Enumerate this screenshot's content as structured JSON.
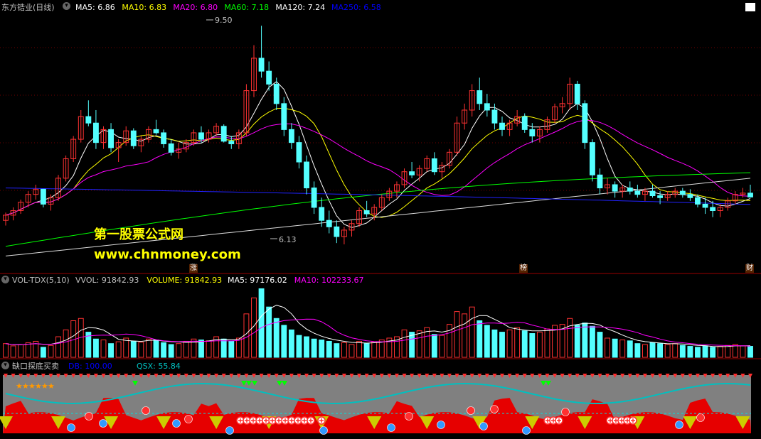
{
  "main_panel": {
    "title": "东方锆业(日线)",
    "ma_labels": [
      {
        "text": "MA5: 6.86",
        "color": "#ffffff"
      },
      {
        "text": "MA10: 6.83",
        "color": "#ffff00"
      },
      {
        "text": "MA20: 6.80",
        "color": "#ff00ff"
      },
      {
        "text": "MA60: 7.18",
        "color": "#00ff00"
      },
      {
        "text": "MA120: 7.24",
        "color": "#ffffff"
      },
      {
        "text": "MA250: 6.58",
        "color": "#0000ff"
      }
    ],
    "high_label": "9.50",
    "low_label": "6.13",
    "watermark_cn": "第一股票公式网",
    "watermark_url": "www.chnmoney.com",
    "badges": [
      "涨",
      "榜",
      "财"
    ]
  },
  "volume_panel": {
    "title": "VOL-TDX(5,10)",
    "labels": [
      {
        "text": "VVOL: 91842.93",
        "color": "#c0c0c0"
      },
      {
        "text": "VOLUME: 91842.93",
        "color": "#ffff00"
      },
      {
        "text": "MA5: 97176.02",
        "color": "#ffffff"
      },
      {
        "text": "MA10: 102233.67",
        "color": "#ff00ff"
      }
    ]
  },
  "indicator_panel": {
    "title": "缺口探底买卖",
    "labels": [
      {
        "text": "DB: 100.00",
        "color": "#0000ff"
      },
      {
        "text": "QSX: 55.84",
        "color": "#00c0c0"
      }
    ]
  },
  "chart_data": {
    "type": "candlestick",
    "price_range": [
      6.13,
      9.5
    ],
    "candles": [
      [
        6.5,
        6.62,
        6.42,
        6.58
      ],
      [
        6.58,
        6.7,
        6.5,
        6.65
      ],
      [
        6.65,
        6.82,
        6.6,
        6.78
      ],
      [
        6.78,
        6.95,
        6.7,
        6.9
      ],
      [
        6.9,
        7.05,
        6.82,
        6.98
      ],
      [
        6.98,
        6.95,
        6.7,
        6.75
      ],
      [
        6.75,
        6.9,
        6.65,
        6.85
      ],
      [
        6.85,
        7.2,
        6.8,
        7.15
      ],
      [
        7.15,
        7.5,
        7.1,
        7.45
      ],
      [
        7.45,
        7.8,
        7.4,
        7.75
      ],
      [
        7.75,
        8.2,
        7.7,
        8.1
      ],
      [
        8.1,
        8.35,
        7.95,
        8.0
      ],
      [
        8.0,
        8.2,
        7.6,
        7.7
      ],
      [
        7.7,
        7.95,
        7.6,
        7.9
      ],
      [
        7.9,
        8.0,
        7.55,
        7.62
      ],
      [
        7.62,
        7.75,
        7.4,
        7.7
      ],
      [
        7.7,
        7.95,
        7.65,
        7.88
      ],
      [
        7.88,
        7.92,
        7.6,
        7.65
      ],
      [
        7.65,
        7.8,
        7.55,
        7.75
      ],
      [
        7.75,
        7.95,
        7.7,
        7.9
      ],
      [
        7.9,
        8.05,
        7.82,
        7.85
      ],
      [
        7.85,
        7.9,
        7.62,
        7.68
      ],
      [
        7.68,
        7.75,
        7.5,
        7.55
      ],
      [
        7.55,
        7.7,
        7.45,
        7.6
      ],
      [
        7.6,
        7.75,
        7.55,
        7.7
      ],
      [
        7.7,
        7.9,
        7.65,
        7.85
      ],
      [
        7.85,
        7.95,
        7.7,
        7.75
      ],
      [
        7.75,
        7.9,
        7.7,
        7.85
      ],
      [
        7.85,
        8.0,
        7.8,
        7.95
      ],
      [
        7.95,
        7.98,
        7.7,
        7.72
      ],
      [
        7.72,
        7.8,
        7.6,
        7.68
      ],
      [
        7.68,
        7.9,
        7.6,
        7.85
      ],
      [
        7.85,
        8.6,
        7.8,
        8.5
      ],
      [
        8.5,
        9.2,
        8.4,
        9.0
      ],
      [
        9.0,
        9.5,
        8.7,
        8.8
      ],
      [
        8.8,
        8.95,
        8.5,
        8.6
      ],
      [
        8.6,
        8.7,
        8.2,
        8.3
      ],
      [
        8.3,
        8.4,
        7.8,
        7.9
      ],
      [
        7.9,
        8.0,
        7.6,
        7.7
      ],
      [
        7.7,
        7.8,
        7.3,
        7.4
      ],
      [
        7.4,
        7.5,
        6.9,
        7.0
      ],
      [
        7.0,
        7.1,
        6.6,
        6.7
      ],
      [
        6.7,
        6.85,
        6.4,
        6.5
      ],
      [
        6.5,
        6.65,
        6.3,
        6.4
      ],
      [
        6.4,
        6.5,
        6.15,
        6.25
      ],
      [
        6.25,
        6.4,
        6.13,
        6.35
      ],
      [
        6.35,
        6.5,
        6.25,
        6.45
      ],
      [
        6.45,
        6.7,
        6.4,
        6.65
      ],
      [
        6.65,
        6.8,
        6.55,
        6.6
      ],
      [
        6.6,
        6.75,
        6.5,
        6.7
      ],
      [
        6.7,
        6.9,
        6.65,
        6.85
      ],
      [
        6.85,
        7.0,
        6.8,
        6.95
      ],
      [
        6.95,
        7.1,
        6.85,
        7.05
      ],
      [
        7.05,
        7.3,
        7.0,
        7.25
      ],
      [
        7.25,
        7.4,
        7.15,
        7.2
      ],
      [
        7.2,
        7.35,
        7.1,
        7.3
      ],
      [
        7.3,
        7.5,
        7.25,
        7.45
      ],
      [
        7.45,
        7.55,
        7.2,
        7.25
      ],
      [
        7.25,
        7.4,
        7.15,
        7.35
      ],
      [
        7.35,
        7.6,
        7.3,
        7.55
      ],
      [
        7.55,
        8.1,
        7.5,
        8.0
      ],
      [
        8.0,
        8.3,
        7.9,
        8.2
      ],
      [
        8.2,
        8.6,
        8.1,
        8.5
      ],
      [
        8.5,
        8.7,
        8.2,
        8.3
      ],
      [
        8.3,
        8.45,
        8.1,
        8.2
      ],
      [
        8.2,
        8.3,
        7.9,
        8.0
      ],
      [
        8.0,
        8.1,
        7.8,
        7.9
      ],
      [
        7.9,
        8.05,
        7.8,
        8.0
      ],
      [
        8.0,
        8.2,
        7.95,
        8.1
      ],
      [
        8.1,
        8.15,
        7.85,
        7.9
      ],
      [
        7.9,
        8.0,
        7.7,
        7.8
      ],
      [
        7.8,
        7.95,
        7.7,
        7.9
      ],
      [
        7.9,
        8.1,
        7.85,
        8.05
      ],
      [
        8.05,
        8.3,
        8.0,
        8.25
      ],
      [
        8.25,
        8.4,
        8.15,
        8.3
      ],
      [
        8.3,
        8.7,
        8.2,
        8.6
      ],
      [
        8.6,
        8.65,
        8.2,
        8.3
      ],
      [
        8.3,
        8.35,
        7.6,
        7.7
      ],
      [
        7.7,
        7.75,
        7.1,
        7.2
      ],
      [
        7.2,
        7.3,
        6.9,
        7.0
      ],
      [
        7.0,
        7.15,
        6.9,
        7.05
      ],
      [
        7.05,
        7.1,
        6.85,
        6.95
      ],
      [
        6.95,
        7.05,
        6.85,
        7.0
      ],
      [
        7.0,
        7.1,
        6.9,
        6.95
      ],
      [
        6.95,
        7.05,
        6.85,
        6.9
      ],
      [
        6.9,
        7.0,
        6.8,
        6.95
      ],
      [
        6.95,
        7.05,
        6.85,
        6.88
      ],
      [
        6.88,
        6.95,
        6.75,
        6.85
      ],
      [
        6.85,
        6.95,
        6.8,
        6.9
      ],
      [
        6.9,
        7.0,
        6.85,
        6.95
      ],
      [
        6.95,
        7.0,
        6.85,
        6.9
      ],
      [
        6.9,
        6.98,
        6.8,
        6.85
      ],
      [
        6.85,
        6.9,
        6.7,
        6.75
      ],
      [
        6.75,
        6.85,
        6.6,
        6.7
      ],
      [
        6.7,
        6.8,
        6.55,
        6.65
      ],
      [
        6.65,
        6.75,
        6.55,
        6.7
      ],
      [
        6.7,
        6.85,
        6.65,
        6.8
      ],
      [
        6.8,
        6.95,
        6.75,
        6.9
      ],
      [
        6.9,
        7.0,
        6.85,
        6.92
      ],
      [
        6.92,
        7.05,
        6.85,
        6.86
      ]
    ],
    "volumes": [
      30,
      25,
      28,
      32,
      35,
      22,
      26,
      45,
      60,
      80,
      85,
      55,
      40,
      38,
      30,
      34,
      42,
      35,
      33,
      40,
      38,
      32,
      28,
      30,
      35,
      40,
      38,
      36,
      45,
      40,
      35,
      42,
      95,
      130,
      150,
      110,
      85,
      70,
      60,
      48,
      45,
      40,
      38,
      35,
      30,
      32,
      28,
      35,
      30,
      34,
      38,
      42,
      45,
      60,
      55,
      58,
      65,
      50,
      48,
      72,
      100,
      95,
      110,
      80,
      70,
      60,
      55,
      60,
      65,
      58,
      52,
      55,
      62,
      70,
      72,
      85,
      70,
      75,
      68,
      55,
      42,
      40,
      38,
      36,
      30,
      28,
      32,
      30,
      28,
      30,
      26,
      24,
      22,
      25,
      22,
      24,
      26,
      28,
      25,
      24
    ]
  }
}
